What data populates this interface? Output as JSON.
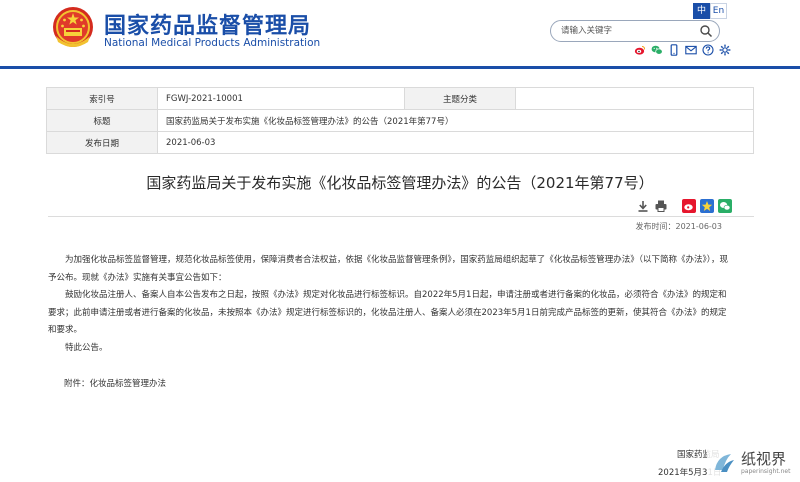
{
  "header": {
    "site_name_cn": "国家药品监督管理局",
    "site_name_en": "National Medical Products Administration",
    "lang": [
      "中",
      "En"
    ],
    "search_placeholder": "请输入关键字",
    "social_icons": [
      "weibo-icon",
      "wechat-icon",
      "mobile-icon",
      "mail-icon",
      "help-icon",
      "settings-icon"
    ],
    "brand_color": "#1a4ea8"
  },
  "meta": {
    "index_label": "索引号",
    "index_value": "FGWJ-2021-10001",
    "topic_label": "主题分类",
    "topic_value": "",
    "title_label": "标题",
    "title_value": "国家药监局关于发布实施《化妆品标签管理办法》的公告（2021年第77号）",
    "date_label": "发布日期",
    "date_value": "2021-06-03"
  },
  "article": {
    "title": "国家药监局关于发布实施《化妆品标签管理办法》的公告（2021年第77号）",
    "pub_date": "发布时间：2021-06-03",
    "paragraphs": [
      "为加强化妆品标签监督管理，规范化妆品标签使用，保障消费者合法权益，依据《化妆品监督管理条例》，国家药监局组织起草了《化妆品标签管理办法》（以下简称《办法》），现予公布。现就《办法》实施有关事宜公告如下：",
      "鼓励化妆品注册人、备案人自本公告发布之日起，按照《办法》规定对化妆品进行标签标识。自2022年5月1日起，申请注册或者进行备案的化妆品，必须符合《办法》的规定和要求；此前申请注册或者进行备案的化妆品，未按照本《办法》规定进行标签标识的，化妆品注册人、备案人必须在2023年5月1日前完成产品标签的更新，使其符合《办法》的规定和要求。",
      "特此公告。"
    ],
    "attachment": "附件：化妆品标签管理办法",
    "signature": "国家药监局",
    "sign_date": "2021年5月31日"
  },
  "watermark": {
    "name_cn": "纸视界",
    "name_en": "paperinsight.net"
  }
}
